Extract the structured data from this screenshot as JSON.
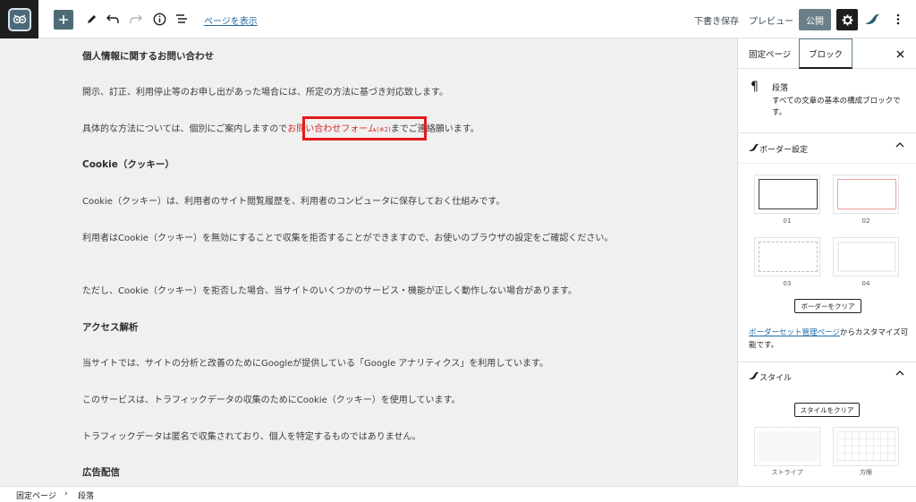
{
  "toolbar": {
    "add_icon": "plus-icon",
    "view_page": "ページを表示",
    "save_draft": "下書き保存",
    "preview": "プレビュー",
    "publish": "公開"
  },
  "content": {
    "p1": "個人情報に関するお問い合わせ",
    "p2": "開示、訂正、利用停止等のお申し出があった場合には、所定の方法に基づき対応致します。",
    "p3_before": "具体的な方法については、個別にご案内しますので",
    "p3_link": "お問い合わせフォーム",
    "p3_note": "(※2)",
    "p3_after": "までご連絡願います。",
    "p4": "Cookie（クッキー）",
    "p5": "Cookie（クッキー）は、利用者のサイト閲覧履歴を、利用者のコンピュータに保存しておく仕組みです。",
    "p6": "利用者はCookie（クッキー）を無効にすることで収集を拒否することができますので、お使いのブラウザの設定をご確認ください。",
    "p7": "ただし、Cookie（クッキー）を拒否した場合、当サイトのいくつかのサービス・機能が正しく動作しない場合があります。",
    "p8": "アクセス解析",
    "p9": "当サイトでは、サイトの分析と改善のためにGoogleが提供している「Google アナリティクス」を利用しています。",
    "p10": "このサービスは、トラフィックデータの収集のためにCookie（クッキー）を使用しています。",
    "p11": "トラフィックデータは匿名で収集されており、個人を特定するものではありません。",
    "p12": "広告配信"
  },
  "sidebar": {
    "tab_page": "固定ページ",
    "tab_block": "ブロック",
    "block_name": "段落",
    "block_desc": "すべての文章の基本の構成ブロックです。",
    "border_panel": "ボーダー設定",
    "border_options": [
      "01",
      "02",
      "03",
      "04"
    ],
    "clear_border": "ボーダーをクリア",
    "note_link": "ボーダーセット管理ページ",
    "note_rest": "からカスタマイズ可能です。",
    "style_panel": "スタイル",
    "clear_style": "スタイルをクリア",
    "style_options": [
      "ストライプ",
      "方眼"
    ]
  },
  "breadcrumb": {
    "item1": "固定ページ",
    "separator": "›",
    "item2": "段落"
  },
  "colors": {
    "accent": "#4f6b78",
    "link": "#1f6ba5",
    "highlight": "#e5191c",
    "red_text": "#d12b2b"
  }
}
